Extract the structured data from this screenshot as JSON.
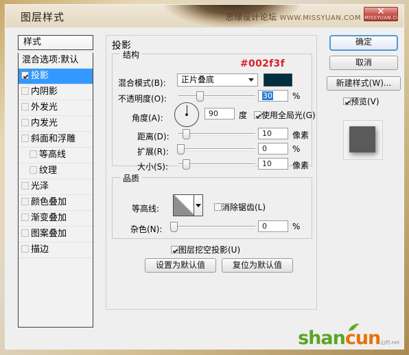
{
  "window": {
    "title": "图层样式",
    "watermark_cn": "思缘设计论坛",
    "watermark_url": "WWW.MISSYUAN.COM",
    "close_label": "✕",
    "close_sub": "MISSYUAN.COM"
  },
  "sidebar": {
    "header_label": "样式",
    "items": [
      {
        "label": "混合选项:默认",
        "type": "header",
        "checked": false,
        "selected": false,
        "indent": false
      },
      {
        "label": "投影",
        "type": "effect",
        "checked": true,
        "selected": true,
        "indent": false
      },
      {
        "label": "内阴影",
        "type": "effect",
        "checked": false,
        "selected": false,
        "indent": false
      },
      {
        "label": "外发光",
        "type": "effect",
        "checked": false,
        "selected": false,
        "indent": false
      },
      {
        "label": "内发光",
        "type": "effect",
        "checked": false,
        "selected": false,
        "indent": false
      },
      {
        "label": "斜面和浮雕",
        "type": "effect",
        "checked": false,
        "selected": false,
        "indent": false
      },
      {
        "label": "等高线",
        "type": "effect",
        "checked": false,
        "selected": false,
        "indent": true
      },
      {
        "label": "纹理",
        "type": "effect",
        "checked": false,
        "selected": false,
        "indent": true
      },
      {
        "label": "光泽",
        "type": "effect",
        "checked": false,
        "selected": false,
        "indent": false
      },
      {
        "label": "颜色叠加",
        "type": "effect",
        "checked": false,
        "selected": false,
        "indent": false
      },
      {
        "label": "渐变叠加",
        "type": "effect",
        "checked": false,
        "selected": false,
        "indent": false
      },
      {
        "label": "图案叠加",
        "type": "effect",
        "checked": false,
        "selected": false,
        "indent": false
      },
      {
        "label": "描边",
        "type": "effect",
        "checked": false,
        "selected": false,
        "indent": false
      }
    ]
  },
  "main": {
    "title": "投影",
    "structure": {
      "caption": "结构",
      "hex_annotation": "#002f3f",
      "blend_mode": {
        "label": "混合模式(B):",
        "value": "正片叠底"
      },
      "color": {
        "hex": "#002f3f"
      },
      "opacity": {
        "label": "不透明度(O):",
        "value": "30",
        "unit": "%",
        "percent": 30
      },
      "angle": {
        "label": "角度(A):",
        "value": "90",
        "unit": "度",
        "degrees": 90
      },
      "global_light": {
        "label": "使用全局光(G)",
        "checked": true
      },
      "distance": {
        "label": "距离(D):",
        "value": "10",
        "unit": "像素",
        "percent": 8
      },
      "spread": {
        "label": "扩展(R):",
        "value": "0",
        "unit": "%",
        "percent": 0
      },
      "size": {
        "label": "大小(S):",
        "value": "10",
        "unit": "像素",
        "percent": 8
      }
    },
    "quality": {
      "caption": "品质",
      "contour": {
        "label": "等高线:"
      },
      "anti_alias": {
        "label": "消除锯齿(L)",
        "checked": false
      },
      "noise": {
        "label": "杂色(N):",
        "value": "0",
        "unit": "%",
        "percent": 0
      }
    },
    "knockout": {
      "label": "图层挖空投影(U)",
      "checked": true
    },
    "set_default_button": "设置为默认值",
    "reset_default_button": "复位为默认值"
  },
  "right": {
    "ok_button": "确定",
    "cancel_button": "取消",
    "new_style_button": "新建样式(W)...",
    "preview": {
      "label": "预览(V)",
      "checked": true
    }
  },
  "footer": {
    "logo_part1": "shan",
    "logo_part2": "cun",
    "logo_tiny1": "山村",
    "logo_tiny2": ".net"
  },
  "colors": {
    "accent": "#3399ff",
    "shadow_color": "#002f3f",
    "annotation_red": "#d9202a",
    "logo_green": "#5ba524",
    "logo_orange": "#e8720c"
  }
}
